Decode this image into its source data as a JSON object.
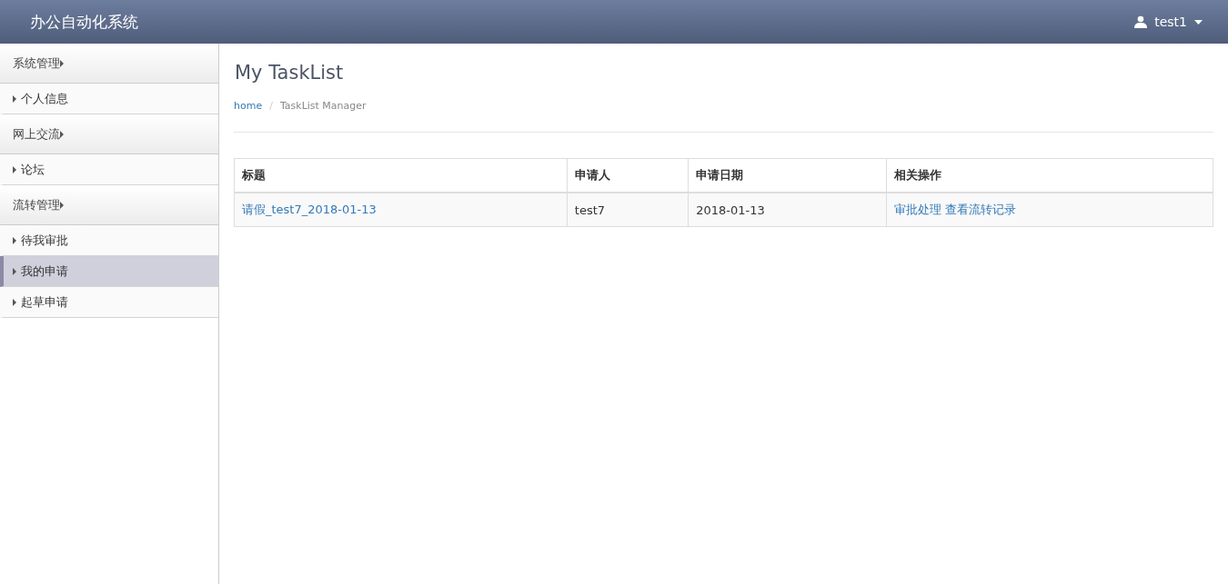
{
  "header": {
    "title": "办公自动化系统",
    "user": "test1"
  },
  "sidebar": {
    "groups": [
      {
        "label": "系统管理",
        "items": [
          {
            "label": "个人信息",
            "selected": false
          }
        ]
      },
      {
        "label": "网上交流",
        "items": [
          {
            "label": "论坛",
            "selected": false
          }
        ]
      },
      {
        "label": "流转管理",
        "items": [
          {
            "label": "待我审批",
            "selected": false
          },
          {
            "label": "我的申请",
            "selected": true
          },
          {
            "label": "起草申请",
            "selected": false
          }
        ]
      }
    ]
  },
  "page": {
    "title": "My TaskList",
    "breadcrumb_separator": "/",
    "breadcrumb": [
      {
        "label": "home",
        "kind": "link"
      },
      {
        "label": "TaskList Manager",
        "kind": "current"
      }
    ]
  },
  "table": {
    "columns": [
      "标题",
      "申请人",
      "申请日期",
      "相关操作"
    ],
    "rows": [
      {
        "title": "请假_test7_2018-01-13",
        "applicant": "test7",
        "date": "2018-01-13",
        "actions": [
          "审批处理",
          "查看流转记录"
        ]
      }
    ]
  }
}
